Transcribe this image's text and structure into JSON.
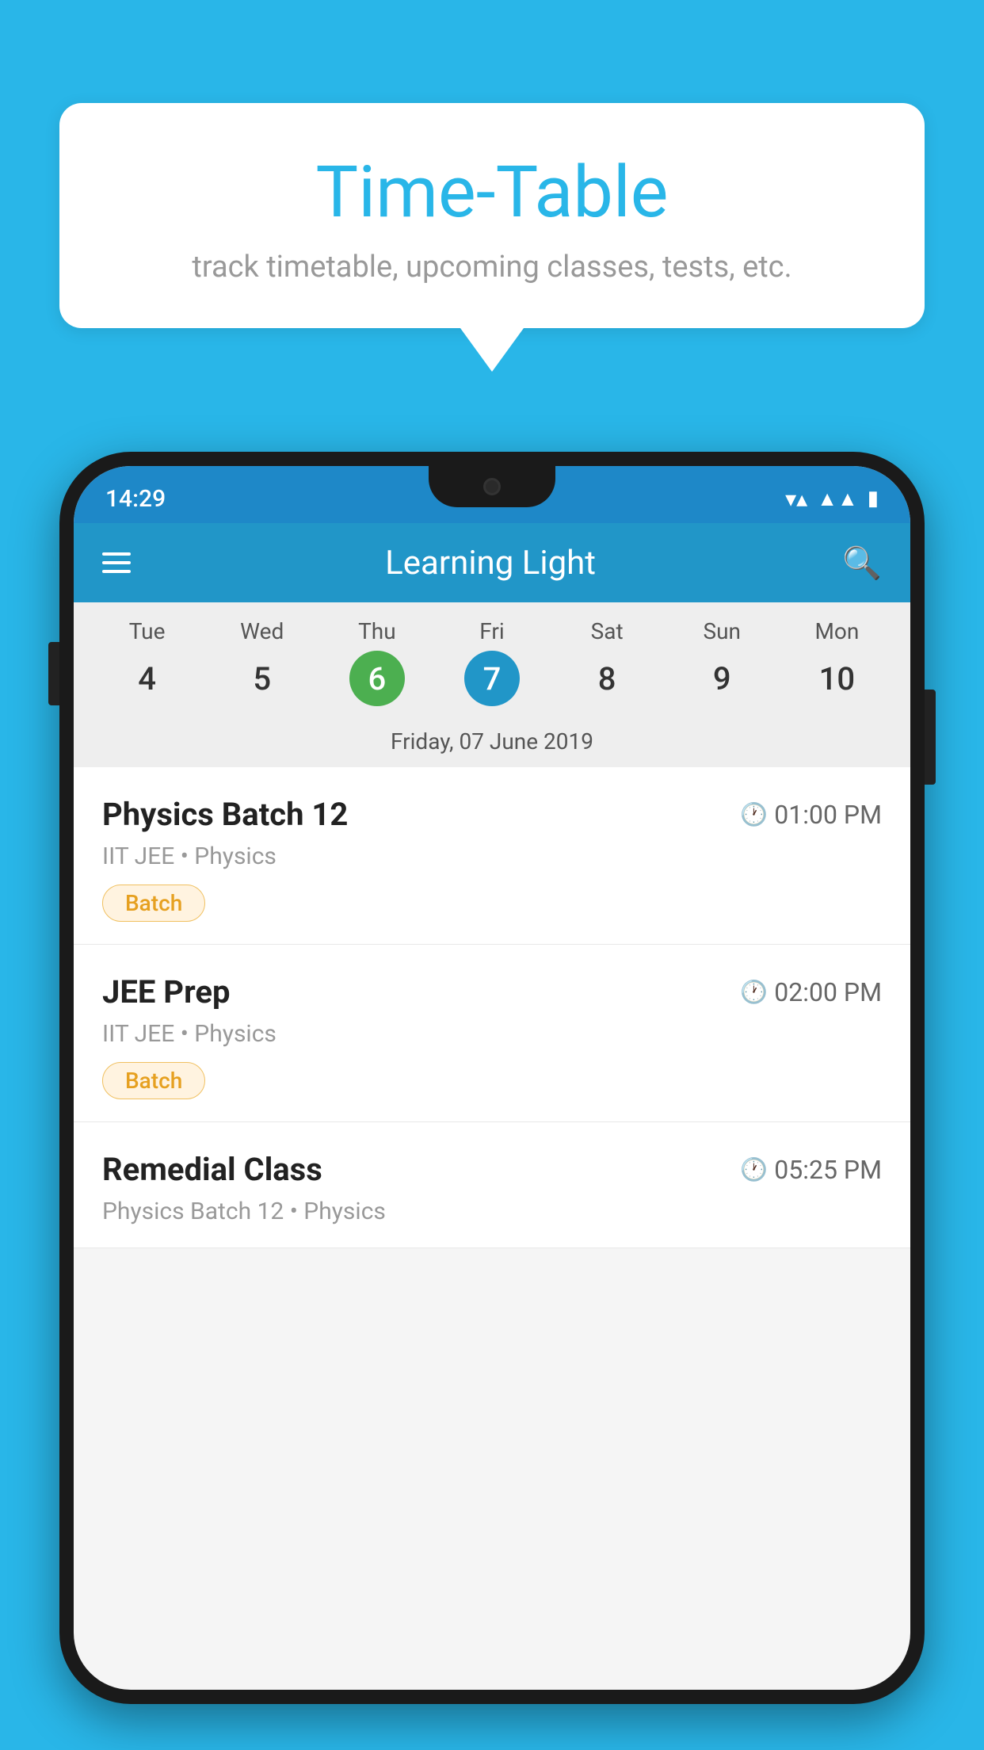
{
  "background_color": "#29b6e8",
  "speech_bubble": {
    "title": "Time-Table",
    "subtitle": "track timetable, upcoming classes, tests, etc."
  },
  "status_bar": {
    "time": "14:29"
  },
  "app_bar": {
    "title": "Learning Light"
  },
  "calendar": {
    "days": [
      {
        "name": "Tue",
        "num": "4",
        "state": "normal"
      },
      {
        "name": "Wed",
        "num": "5",
        "state": "normal"
      },
      {
        "name": "Thu",
        "num": "6",
        "state": "today"
      },
      {
        "name": "Fri",
        "num": "7",
        "state": "selected"
      },
      {
        "name": "Sat",
        "num": "8",
        "state": "normal"
      },
      {
        "name": "Sun",
        "num": "9",
        "state": "normal"
      },
      {
        "name": "Mon",
        "num": "10",
        "state": "normal"
      }
    ],
    "selected_date_label": "Friday, 07 June 2019"
  },
  "schedule_items": [
    {
      "title": "Physics Batch 12",
      "time": "01:00 PM",
      "subtitle": "IIT JEE • Physics",
      "badge": "Batch"
    },
    {
      "title": "JEE Prep",
      "time": "02:00 PM",
      "subtitle": "IIT JEE • Physics",
      "badge": "Batch"
    },
    {
      "title": "Remedial Class",
      "time": "05:25 PM",
      "subtitle": "Physics Batch 12 • Physics",
      "badge": ""
    }
  ],
  "icons": {
    "hamburger": "☰",
    "search": "🔍",
    "clock": "🕐"
  }
}
